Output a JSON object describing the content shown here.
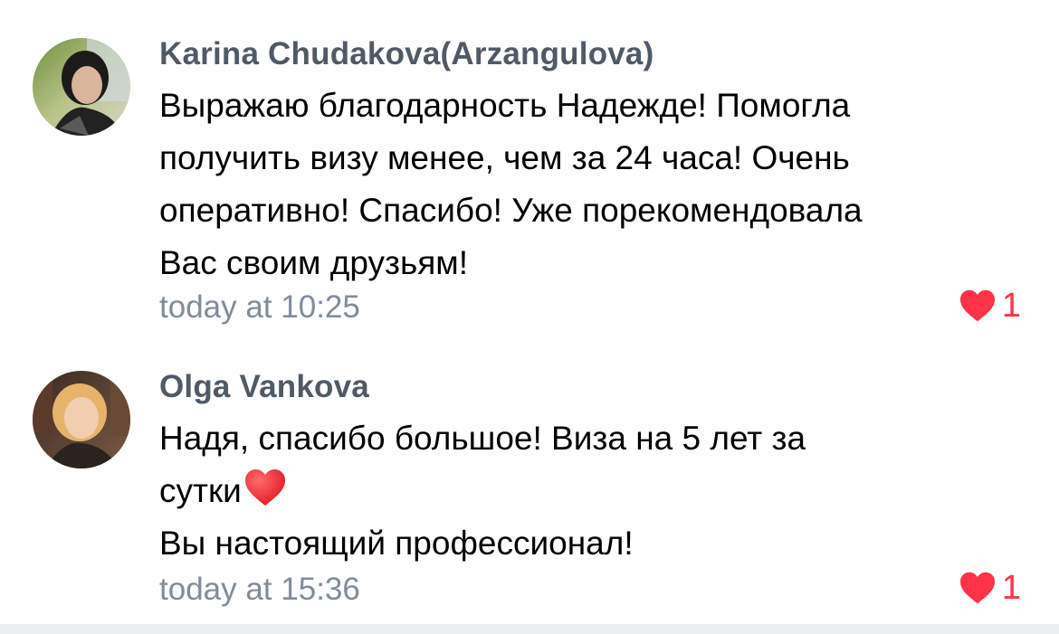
{
  "comments": [
    {
      "author": "Karina Chudakova(Arzangulova)",
      "lines": [
        "Выражаю благодарность Надежде! Помогла",
        "получить визу менее, чем за 24 часа! Очень",
        "оперативно! Спасибо! Уже порекомендовала",
        "Вас своим друзьям!"
      ],
      "time": "today at 10:25",
      "likes": "1",
      "like_color": "#ff3347",
      "avatar_icon": "avatar-photo"
    },
    {
      "author": "Olga Vankova",
      "lines": [
        "Надя, спасибо большое! Виза на 5 лет за",
        "сутки",
        "Вы настоящий профессионал!"
      ],
      "inline_emoji": "red-heart-emoji",
      "time": "today at 15:36",
      "likes": "1",
      "like_color": "#ff3347",
      "avatar_icon": "avatar-photo"
    }
  ],
  "colors": {
    "author": "#505a66",
    "time": "#818c99",
    "text": "#000000",
    "like": "#ff3347",
    "separator": "#ebedf0"
  }
}
